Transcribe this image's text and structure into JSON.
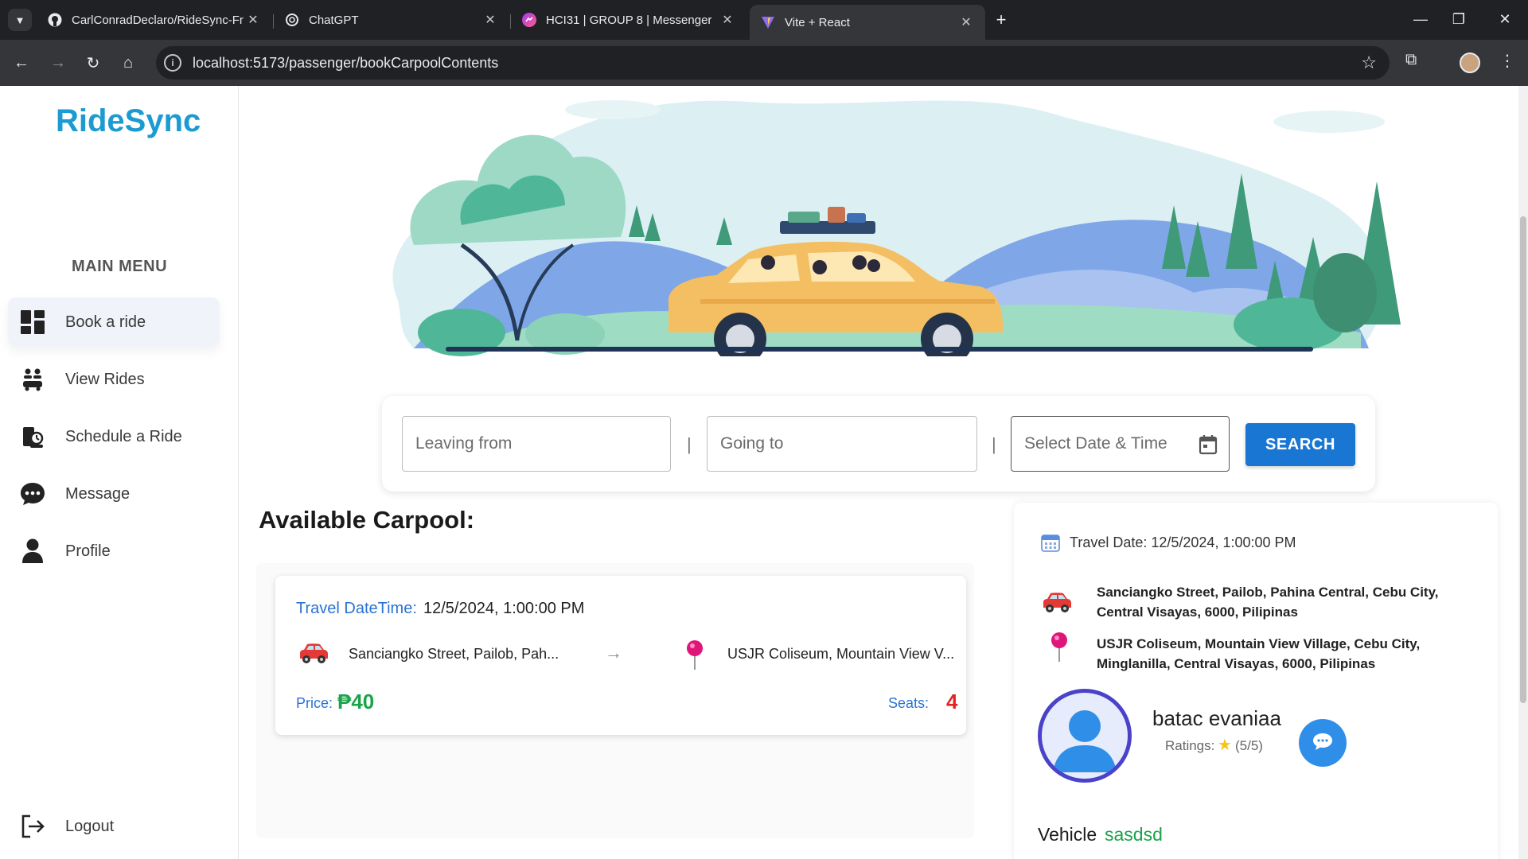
{
  "browser": {
    "tabs": [
      {
        "title": "CarlConradDeclaro/RideSync-Fr",
        "icon": "github-icon"
      },
      {
        "title": "ChatGPT",
        "icon": "chatgpt-icon"
      },
      {
        "title": "HCI31 | GROUP 8 | Messenger",
        "icon": "messenger-icon"
      },
      {
        "title": "Vite + React",
        "icon": "vite-icon"
      }
    ],
    "url": "localhost:5173/passenger/bookCarpoolContents"
  },
  "sidebar": {
    "brand": "RideSync",
    "menu_title": "MAIN MENU",
    "items": [
      {
        "label": "Book a ride",
        "icon": "dashboard-icon"
      },
      {
        "label": "View Rides",
        "icon": "people-car-icon"
      },
      {
        "label": "Schedule a Ride",
        "icon": "schedule-icon"
      },
      {
        "label": "Message",
        "icon": "chat-icon"
      },
      {
        "label": "Profile",
        "icon": "user-icon"
      }
    ],
    "logout": "Logout"
  },
  "search": {
    "leaving_placeholder": "Leaving from",
    "going_placeholder": "Going to",
    "date_placeholder": "Select Date & Time",
    "separator": "|",
    "button": "SEARCH"
  },
  "available": {
    "title": "Available Carpool:",
    "card": {
      "datetime_label": "Travel DateTime:",
      "datetime_value": "12/5/2024, 1:00:00 PM",
      "from": "Sanciangko Street, Pailob, Pah...",
      "arrow": "→",
      "to": "USJR Coliseum, Mountain View V...",
      "price_label": "Price:",
      "price_value": "₱40",
      "seats_label": "Seats:",
      "seats_value": "4"
    }
  },
  "detail": {
    "travel_date": "Travel Date: 12/5/2024, 1:00:00 PM",
    "from_address": "Sanciangko Street, Pailob, Pahina Central, Cebu City, Central Visayas, 6000, Pilipinas",
    "to_address": "USJR Coliseum, Mountain View Village, Cebu City, Minglanilla, Central Visayas, 6000, Pilipinas",
    "driver_name": "batac evaniaa",
    "ratings_label": "Ratings:",
    "ratings_value": "(5/5)",
    "vehicle_label": "Vehicle",
    "vehicle_value": "sasdsd"
  },
  "colors": {
    "brand": "#1b9bd1",
    "primary_button": "#1976d2",
    "price": "#1aa34a",
    "seats": "#e02424",
    "label_blue": "#2a73d4"
  }
}
